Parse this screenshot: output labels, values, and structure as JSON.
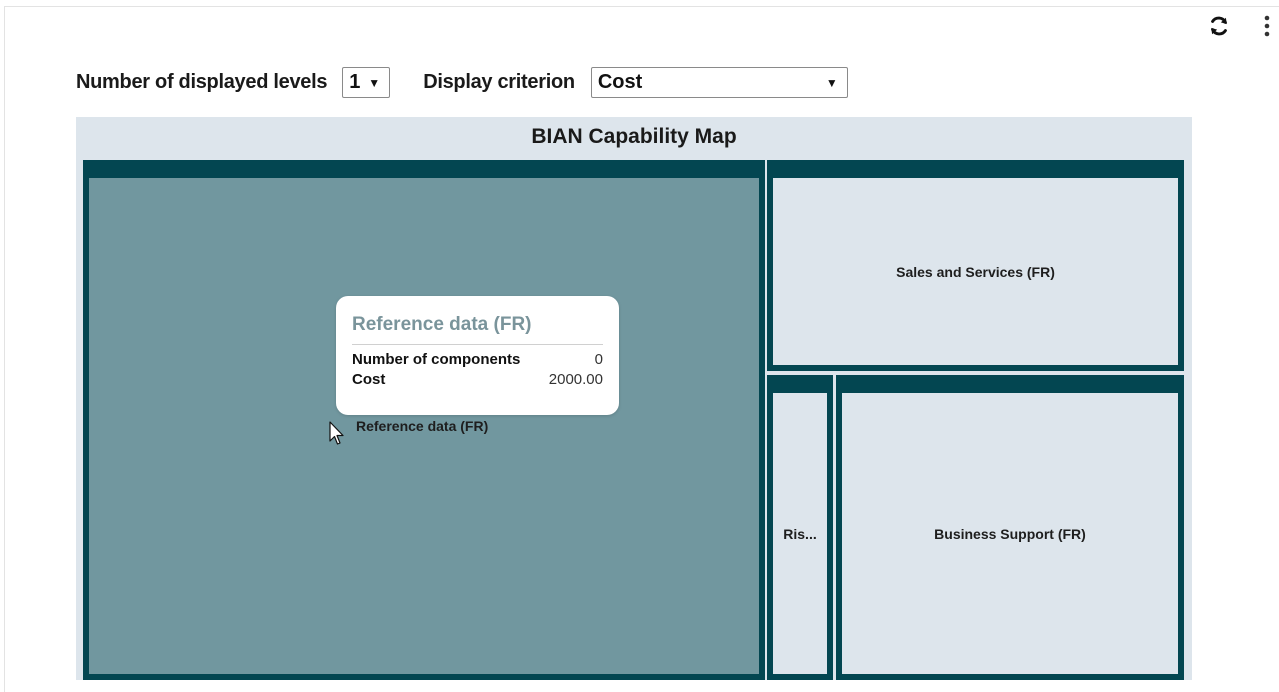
{
  "toolbar": {
    "refresh_icon": "refresh-icon",
    "menu_icon": "more-vertical-icon"
  },
  "controls": {
    "levels_label": "Number of displayed levels",
    "levels_value": "1",
    "criterion_label": "Display criterion",
    "criterion_value": "Cost"
  },
  "chart_data": {
    "type": "treemap",
    "title": "BIAN Capability Map",
    "items": [
      {
        "label": "Reference data (FR)",
        "state": "hovered"
      },
      {
        "label": "Sales and Services (FR)",
        "state": "normal"
      },
      {
        "label": "Ris...",
        "state": "normal"
      },
      {
        "label": "Business Support (FR)",
        "state": "normal"
      }
    ],
    "tooltip": {
      "title": "Reference data (FR)",
      "rows": [
        {
          "key": "Number of components",
          "value": "0"
        },
        {
          "key": "Cost",
          "value": "2000.00"
        }
      ]
    },
    "colors": {
      "border": "#034651",
      "tile": "#dde5ec",
      "hover_tile": "#71979f",
      "tooltip_title": "#7a949b"
    }
  }
}
